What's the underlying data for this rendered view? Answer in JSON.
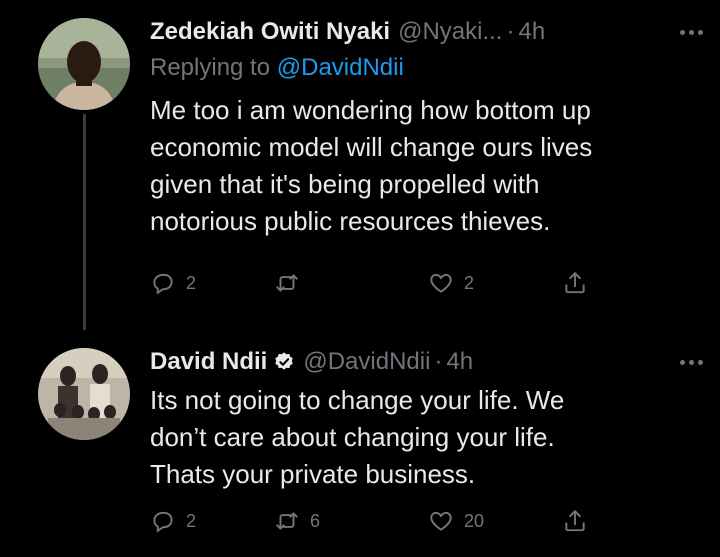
{
  "tweets": [
    {
      "author_name": "Zedekiah Owiti Nyaki",
      "handle": "@Nyaki...",
      "dot": "·",
      "time": "4h",
      "reply_prefix": "Replying to",
      "reply_to": "@DavidNdii",
      "verified": false,
      "text_lines": [
        "Me too i am wondering how bottom up",
        "economic model will change ours lives",
        "given that it's being propelled with",
        "notorious public resources thieves."
      ],
      "reply_count": "2",
      "retweet_count": "",
      "like_count": "2"
    },
    {
      "author_name": "David Ndii",
      "handle": "@DavidNdii",
      "dot": "·",
      "time": "4h",
      "verified": true,
      "text_lines": [
        "Its not going to change your life. We",
        "don’t care about changing your life.",
        "Thats your private business."
      ],
      "reply_count": "2",
      "retweet_count": "6",
      "like_count": "20"
    }
  ],
  "icons": {
    "reply": "speech-bubble-icon",
    "retweet": "retweet-icon",
    "like": "heart-icon",
    "share": "share-icon",
    "more": "more-dots-icon",
    "verified": "verified-badge-icon"
  },
  "colors": {
    "background": "#000000",
    "text": "#e7e9ea",
    "muted": "#71767b",
    "link": "#1d9bf0",
    "thread_line": "#3a3d40"
  }
}
